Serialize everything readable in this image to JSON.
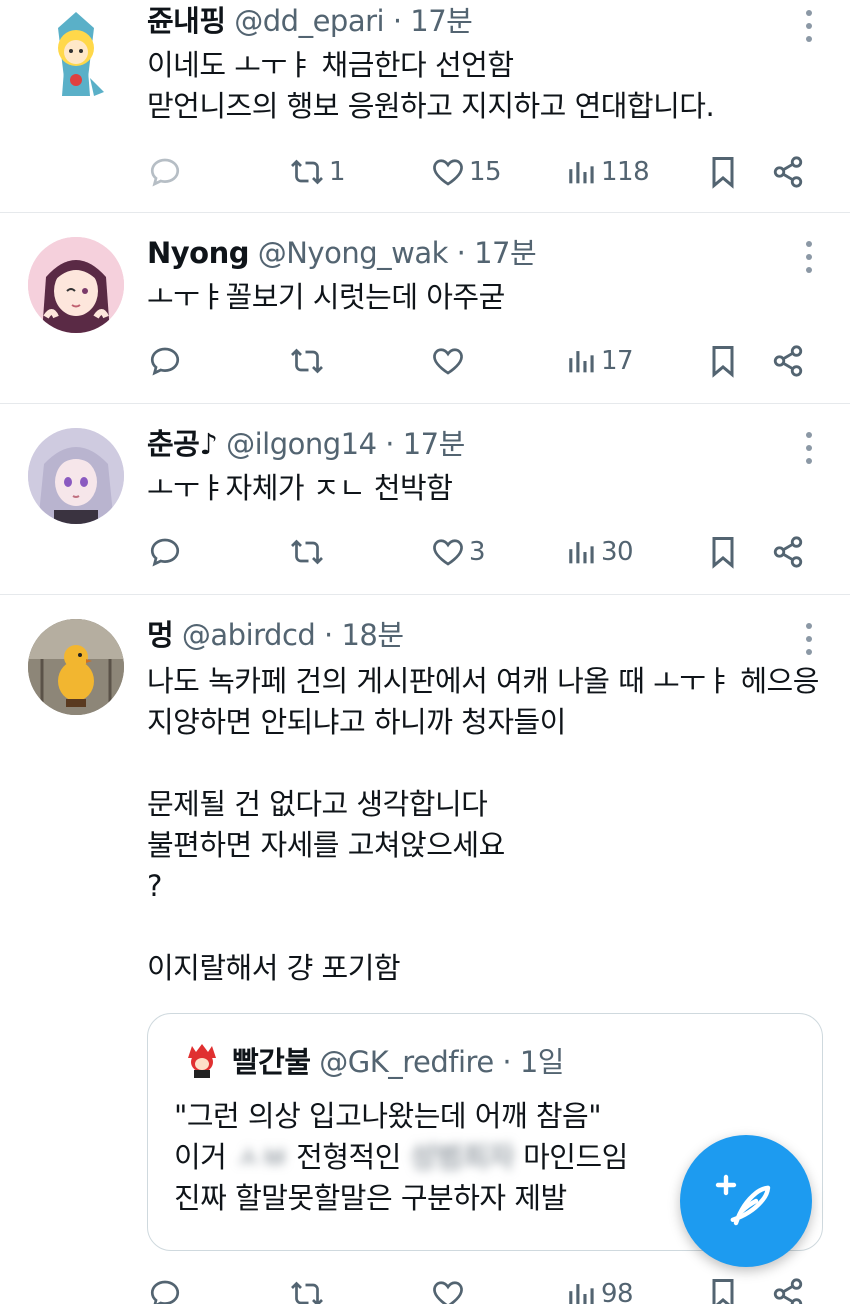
{
  "tweets": [
    {
      "name": "쥰내핑",
      "handle": "@dd_epari",
      "dot": "·",
      "time": "17분",
      "lines": [
        "이네도 ㅗㅜㅑ 채금한다 선언함",
        "맏언니즈의 행보 응원하고 지지하고 연대합니다."
      ],
      "stats": {
        "replies": "",
        "retweets": "1",
        "likes": "15",
        "views": "118"
      }
    },
    {
      "name": "Nyong",
      "handle": "@Nyong_wak",
      "dot": "·",
      "time": "17분",
      "lines": [
        "ㅗㅜㅑ꼴보기 시럿는데 아주굳"
      ],
      "stats": {
        "replies": "",
        "retweets": "",
        "likes": "",
        "views": "17"
      }
    },
    {
      "name": "춘공♪",
      "handle": "@ilgong14",
      "dot": "·",
      "time": "17분",
      "lines": [
        "ㅗㅜㅑ자체가 ㅈㄴ 천박함"
      ],
      "stats": {
        "replies": "",
        "retweets": "",
        "likes": "3",
        "views": "30"
      }
    },
    {
      "name": "멍",
      "handle": "@abirdcd",
      "dot": "·",
      "time": "18분",
      "lines": [
        "나도 녹카페 건의 게시판에서 여캐 나올 때 ㅗㅜㅑ 헤으응",
        "지양하면 안되냐고 하니까 청자들이",
        "",
        "문제될 건 없다고 생각합니다",
        "불편하면 자세를 고쳐앉으세요",
        "?",
        "",
        "이지랄해서 걍 포기함"
      ],
      "stats": {
        "replies": "",
        "retweets": "",
        "likes": "",
        "views": "98"
      },
      "quote": {
        "name": "빨간불",
        "handle": "@GK_redfire",
        "dot": "·",
        "time": "1일",
        "line1": "\"그런 의상 입고나왔는데 어깨 참음\"",
        "line2_a": "이거 ",
        "line2_b": "ㅅㅂ",
        "line2_c": " 전형적인 ",
        "line2_d": "성범죄자",
        "line2_e": " 마인드임",
        "line3": "진짜 할말못할말은 구분하자 제발"
      }
    }
  ],
  "colors": {
    "accent": "#1d9bf0",
    "muted": "#536471",
    "text": "#0f1419",
    "divider": "#e6e9ec"
  },
  "icons": {
    "reply": "reply-icon",
    "retweet": "retweet-icon",
    "like": "heart-icon",
    "views": "views-icon",
    "bookmark": "bookmark-icon",
    "share": "share-icon",
    "more": "more-icon",
    "compose": "compose-icon"
  }
}
